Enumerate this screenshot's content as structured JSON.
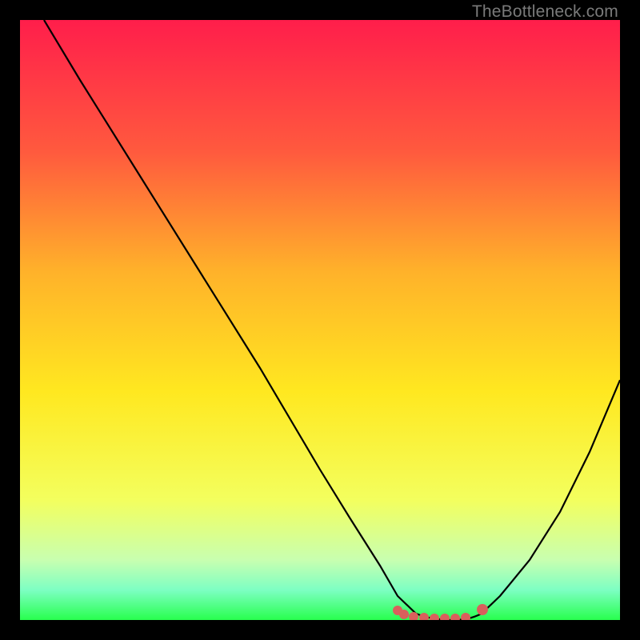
{
  "watermark": "TheBottleneck.com",
  "chart_data": {
    "type": "line",
    "title": "",
    "xlabel": "",
    "ylabel": "",
    "xlim": [
      0,
      100
    ],
    "ylim": [
      0,
      100
    ],
    "series": [
      {
        "name": "curve",
        "x": [
          4,
          10,
          20,
          30,
          40,
          50,
          55,
          60,
          63,
          66,
          70,
          73,
          77,
          80,
          85,
          90,
          95,
          100
        ],
        "values": [
          100,
          90,
          74,
          58,
          42,
          25,
          17,
          9,
          4,
          1,
          0,
          0,
          1,
          4,
          10,
          18,
          28,
          40
        ]
      }
    ],
    "markers": {
      "name": "bottom-band",
      "color": "#d9605c",
      "x_start": 63,
      "x_end": 77,
      "y": 0.5
    },
    "background_gradient": {
      "top": "#ff1e4b",
      "mid1": "#ff913c",
      "mid2": "#ffe820",
      "mid3": "#f6ff70",
      "bottom": "#28ff4e"
    }
  }
}
